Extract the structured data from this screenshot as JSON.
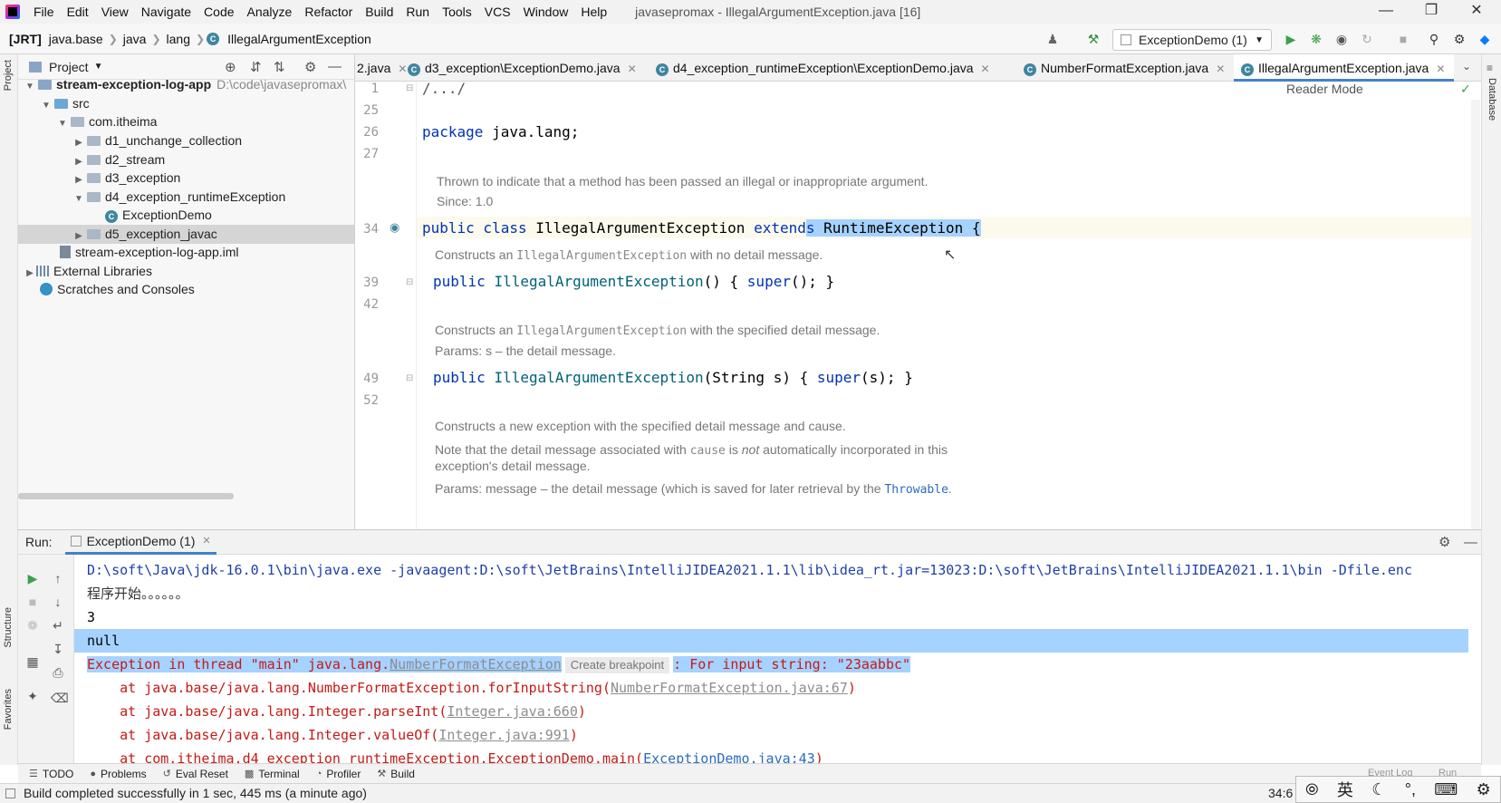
{
  "menubar": {
    "items": [
      "File",
      "Edit",
      "View",
      "Navigate",
      "Code",
      "Analyze",
      "Refactor",
      "Build",
      "Run",
      "Tools",
      "VCS",
      "Window",
      "Help"
    ],
    "title": "javasepromax - IllegalArgumentException.java [16]"
  },
  "navbar": {
    "crumbs": [
      "[JRT]",
      "java.base",
      "java",
      "lang",
      "IllegalArgumentException"
    ],
    "run_config": "ExceptionDemo (1)"
  },
  "sidebar": {
    "left_labels": [
      "Project",
      "Structure",
      "Favorites"
    ],
    "right_label": "Database"
  },
  "project": {
    "header": "Project",
    "tree": [
      {
        "label": "stream-exception-log-app",
        "suffix": "D:\\code\\javasepromax\\",
        "bold": true
      },
      {
        "label": "src"
      },
      {
        "label": "com.itheima"
      },
      {
        "label": "d1_unchange_collection"
      },
      {
        "label": "d2_stream"
      },
      {
        "label": "d3_exception"
      },
      {
        "label": "d4_exception_runtimeException"
      },
      {
        "label": "ExceptionDemo"
      },
      {
        "label": "d5_exception_javac"
      },
      {
        "label": "stream-exception-log-app.iml"
      },
      {
        "label": "External Libraries"
      },
      {
        "label": "Scratches and Consoles"
      }
    ]
  },
  "editor_tabs": [
    {
      "label": "2.java"
    },
    {
      "label": "d3_exception\\ExceptionDemo.java"
    },
    {
      "label": "d4_exception_runtimeException\\ExceptionDemo.java"
    },
    {
      "label": "NumberFormatException.java"
    },
    {
      "label": "IllegalArgumentException.java",
      "active": true
    }
  ],
  "editor": {
    "reader_mode": "Reader Mode",
    "line_numbers": [
      "1",
      "25",
      "26",
      "27",
      "34",
      "39",
      "42",
      "49",
      "52"
    ],
    "fold": "/.../",
    "package_kw": "package",
    "package_name": " java.lang;",
    "doc1": "Thrown to indicate that a method has been passed an illegal or inappropriate argument.",
    "doc1_since": "Since: 1.0",
    "class_decl": {
      "public": "public",
      "class": " class ",
      "name": "IllegalArgumentException ",
      "extends_a": "extend",
      "extends_b": "s",
      "super": " RuntimeException {"
    },
    "doc2_pre": "Constructs an ",
    "doc2_code": "IllegalArgumentException",
    "doc2_post": " with no detail message.",
    "ctor1": {
      "public": "public ",
      "name": "IllegalArgumentException",
      "rest": "() { ",
      "super": "super",
      "end": "(); }"
    },
    "doc3_pre": "Constructs an ",
    "doc3_code": "IllegalArgumentException",
    "doc3_post": " with the specified detail message.",
    "doc3_params": "Params: s – the detail message.",
    "ctor2": {
      "public": "public ",
      "name": "IllegalArgumentException",
      "rest": "(String s) { ",
      "super": "super",
      "end": "(s); }"
    },
    "doc4": "Constructs a new exception with the specified detail message and cause.",
    "doc5_pre": "Note that the detail message associated with ",
    "doc5_code": "cause",
    "doc5_mid": " is ",
    "doc5_em": "not",
    "doc5_post": " automatically incorporated in this",
    "doc5_line2": "exception's detail message.",
    "doc6_pre": "Params: message – the detail message (which is saved for later retrieval by the ",
    "doc6_link": "Throwable",
    "doc6_post": "."
  },
  "run": {
    "label": "Run:",
    "tab": "ExceptionDemo (1)",
    "console": {
      "cmd": "D:\\soft\\Java\\jdk-16.0.1\\bin\\java.exe -javaagent:D:\\soft\\JetBrains\\IntelliJIDEA2021.1.1\\lib\\idea_rt.jar=13023:D:\\soft\\JetBrains\\IntelliJIDEA2021.1.1\\bin -Dfile.enc",
      "l1": "程序开始。。。。。。",
      "l2": "3",
      "l3": "null",
      "ex_pre": "Exception in thread \"main\" java.lang.",
      "ex_link": "NumberFormatException",
      "ex_chip": "Create breakpoint",
      "ex_post": ": For input string: \"23aabbc\"",
      "st1_pre": "    at java.base/java.lang.NumberFormatException.forInputString(",
      "st1_link": "NumberFormatException.java:67",
      "st1_post": ")",
      "st2_pre": "    at java.base/java.lang.Integer.parseInt(",
      "st2_link": "Integer.java:660",
      "st2_post": ")",
      "st3_pre": "    at java.base/java.lang.Integer.valueOf(",
      "st3_link": "Integer.java:991",
      "st3_post": ")",
      "st4_pre": "    at com.itheima.d4_exception_runtimeException.ExceptionDemo.main(",
      "st4_link": "ExceptionDemo.java:43",
      "st4_post": ")"
    }
  },
  "bottom_tools": [
    "TODO",
    "Problems",
    "Eval Reset",
    "Terminal",
    "Profiler",
    "Build"
  ],
  "bottom_right": [
    "Event Log",
    "Run"
  ],
  "status": {
    "message": "Build completed successfully in 1 sec, 445 ms (a minute ago)",
    "position": "34:6"
  },
  "ime": {
    "lang": "英"
  }
}
